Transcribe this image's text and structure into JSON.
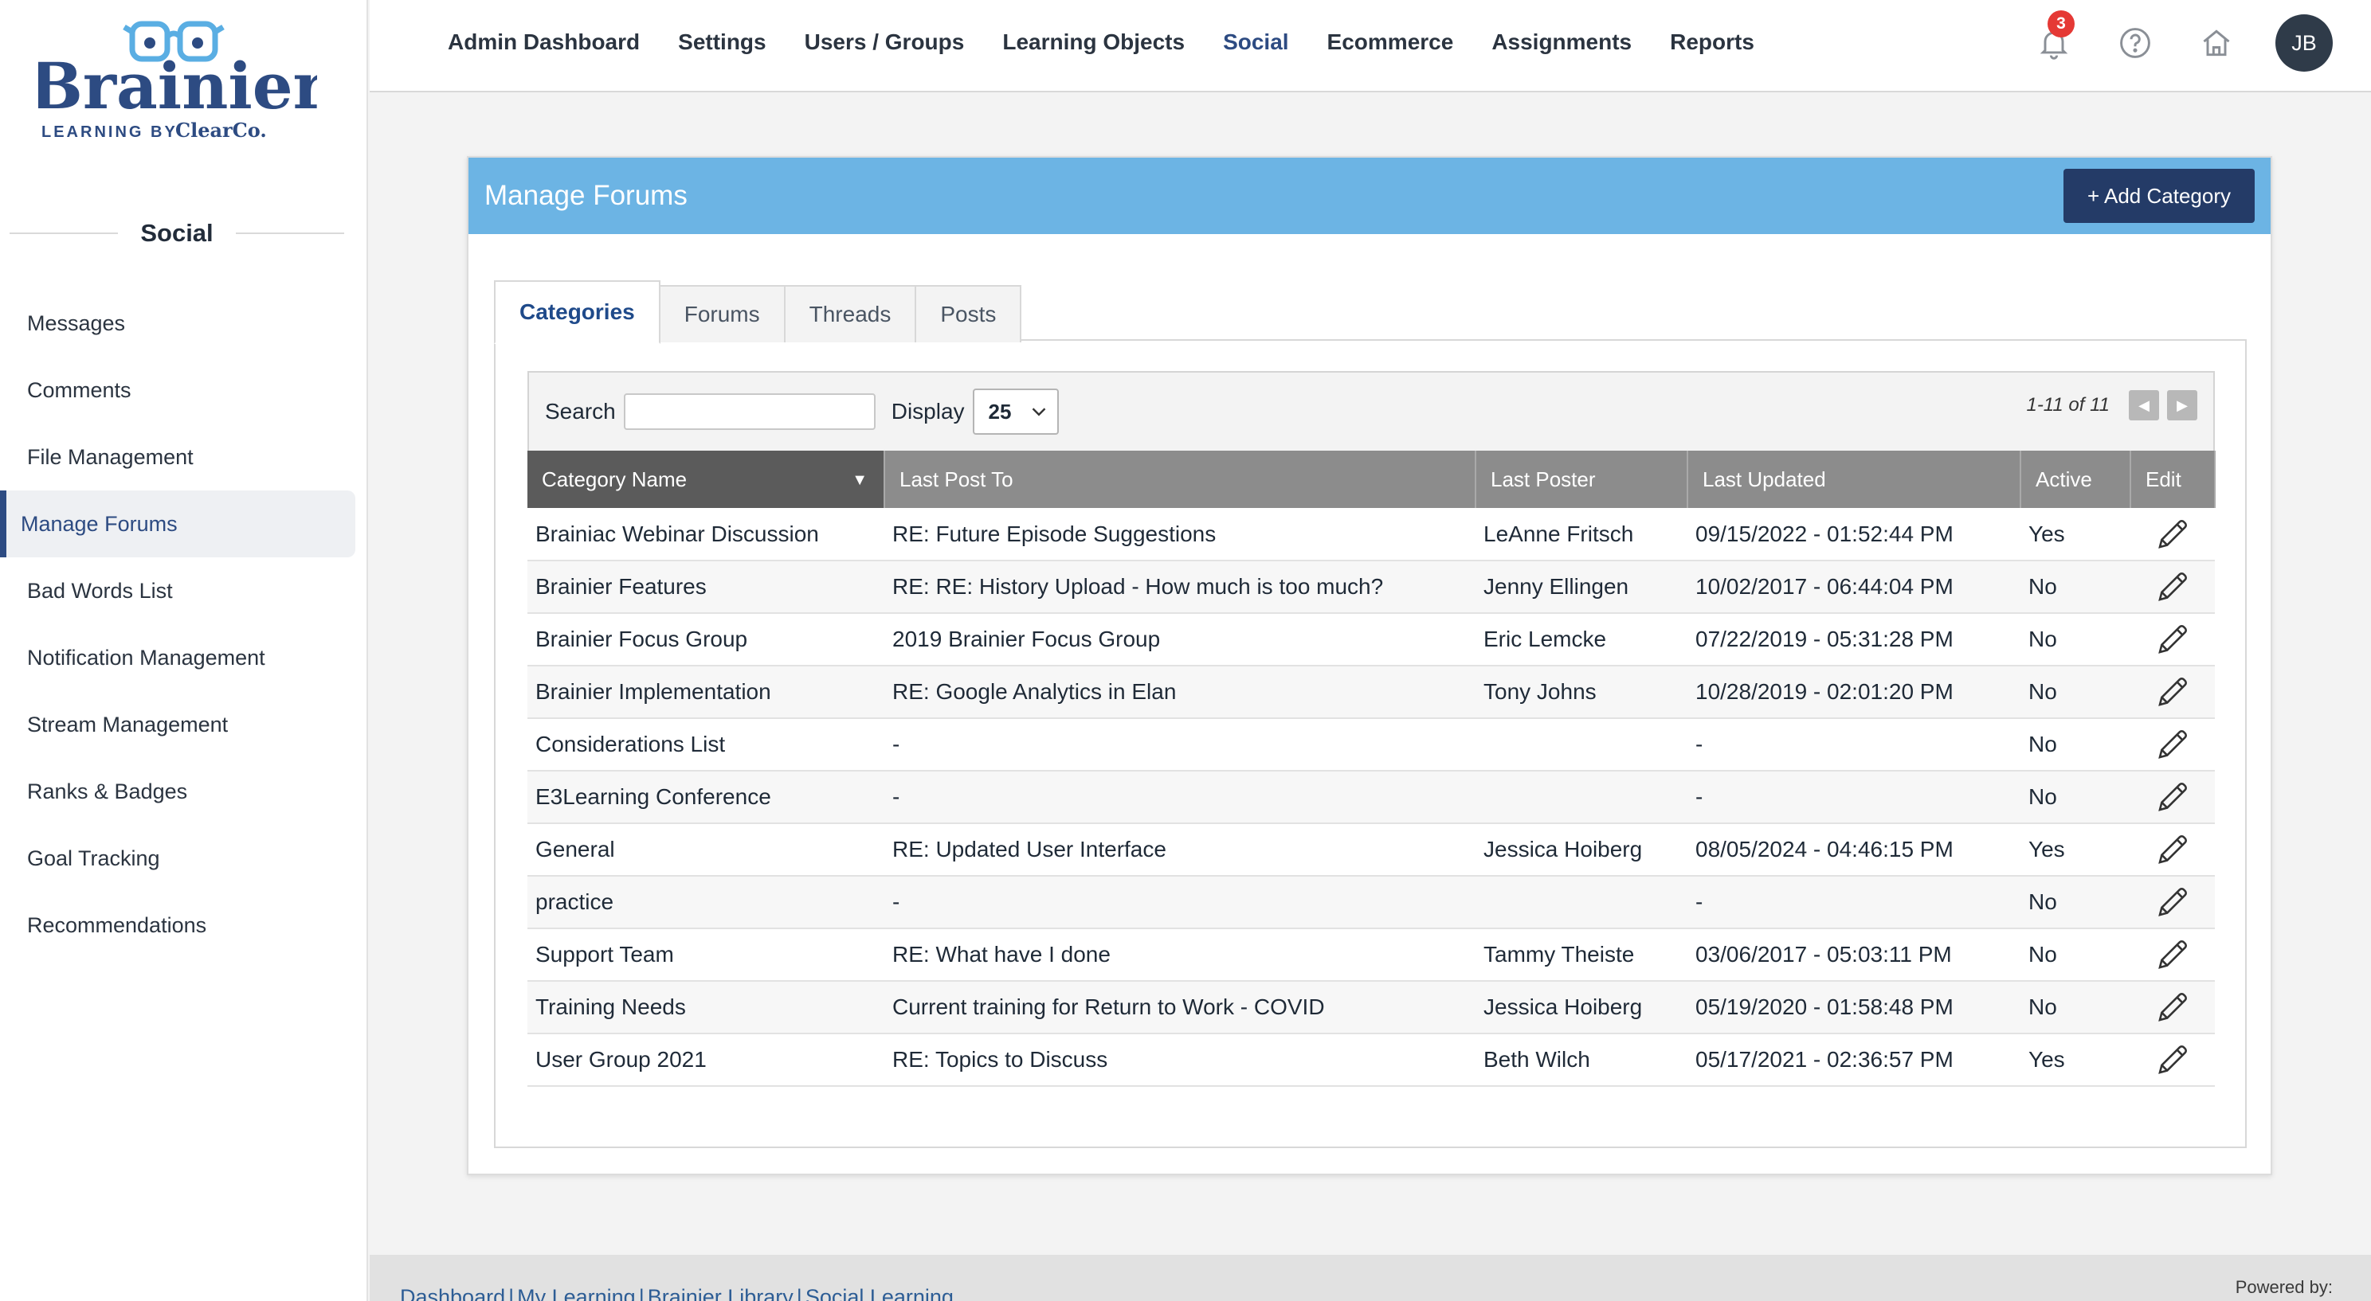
{
  "brand": {
    "name": "Brainier",
    "tagline": "LEARNING BY",
    "company": "ClearCo."
  },
  "sidebar": {
    "section_title": "Social",
    "items": [
      {
        "label": "Messages",
        "active": false
      },
      {
        "label": "Comments",
        "active": false
      },
      {
        "label": "File Management",
        "active": false
      },
      {
        "label": "Manage Forums",
        "active": true
      },
      {
        "label": "Bad Words List",
        "active": false
      },
      {
        "label": "Notification Management",
        "active": false
      },
      {
        "label": "Stream Management",
        "active": false
      },
      {
        "label": "Ranks & Badges",
        "active": false
      },
      {
        "label": "Goal Tracking",
        "active": false
      },
      {
        "label": "Recommendations",
        "active": false
      }
    ]
  },
  "topnav": {
    "items": [
      {
        "label": "Admin Dashboard",
        "active": false
      },
      {
        "label": "Settings",
        "active": false
      },
      {
        "label": "Users / Groups",
        "active": false
      },
      {
        "label": "Learning Objects",
        "active": false
      },
      {
        "label": "Social",
        "active": true
      },
      {
        "label": "Ecommerce",
        "active": false
      },
      {
        "label": "Assignments",
        "active": false
      },
      {
        "label": "Reports",
        "active": false
      }
    ],
    "notification_count": "3",
    "icons": [
      "bell-icon",
      "help-icon",
      "home-icon"
    ],
    "avatar_initials": "JB"
  },
  "panel": {
    "title": "Manage Forums",
    "add_button": "+ Add Category",
    "tabs": [
      {
        "label": "Categories",
        "active": true
      },
      {
        "label": "Forums",
        "active": false
      },
      {
        "label": "Threads",
        "active": false
      },
      {
        "label": "Posts",
        "active": false
      }
    ]
  },
  "grid": {
    "search_label": "Search",
    "search_value": "",
    "display_label": "Display",
    "display_value": "25",
    "page_range": "1-11 of 11",
    "columns": [
      "Category Name",
      "Last Post To",
      "Last Poster",
      "Last Updated",
      "Active",
      "Edit"
    ],
    "rows": [
      {
        "name": "Brainiac Webinar Discussion",
        "last_post": "RE: Future Episode Suggestions",
        "poster": "LeAnne Fritsch",
        "updated": "09/15/2022 - 01:52:44 PM",
        "active": "Yes"
      },
      {
        "name": "Brainier Features",
        "last_post": "RE: RE: History Upload - How much is too much?",
        "poster": "Jenny Ellingen",
        "updated": "10/02/2017 - 06:44:04 PM",
        "active": "No"
      },
      {
        "name": "Brainier Focus Group",
        "last_post": "2019 Brainier Focus Group",
        "poster": "Eric Lemcke",
        "updated": "07/22/2019 - 05:31:28 PM",
        "active": "No"
      },
      {
        "name": "Brainier Implementation",
        "last_post": "RE: Google Analytics in Elan",
        "poster": "Tony Johns",
        "updated": "10/28/2019 - 02:01:20 PM",
        "active": "No"
      },
      {
        "name": "Considerations List",
        "last_post": "-",
        "poster": "",
        "updated": "-",
        "active": "No"
      },
      {
        "name": "E3Learning Conference",
        "last_post": "-",
        "poster": "",
        "updated": "-",
        "active": "No"
      },
      {
        "name": "General",
        "last_post": "RE: Updated User Interface",
        "poster": "Jessica Hoiberg",
        "updated": "08/05/2024 - 04:46:15 PM",
        "active": "Yes"
      },
      {
        "name": "practice",
        "last_post": "-",
        "poster": "",
        "updated": "-",
        "active": "No"
      },
      {
        "name": "Support Team",
        "last_post": "RE: What have I done",
        "poster": "Tammy Theiste",
        "updated": "03/06/2017 - 05:03:11 PM",
        "active": "No"
      },
      {
        "name": "Training Needs",
        "last_post": "Current training for Return to Work - COVID",
        "poster": "Jessica Hoiberg",
        "updated": "05/19/2020 - 01:58:48 PM",
        "active": "No"
      },
      {
        "name": "User Group 2021",
        "last_post": "RE: Topics to Discuss",
        "poster": "Beth Wilch",
        "updated": "05/17/2021 - 02:36:57 PM",
        "active": "Yes"
      }
    ]
  },
  "footer": {
    "links": [
      "Dashboard",
      "My Learning",
      "Brainier Library",
      "Social Learning"
    ],
    "powered_by": "Powered by:"
  },
  "colors": {
    "accent": "#2d4b82",
    "panel_header": "#6cb4e4",
    "button": "#243b67",
    "badge": "#e53935"
  }
}
